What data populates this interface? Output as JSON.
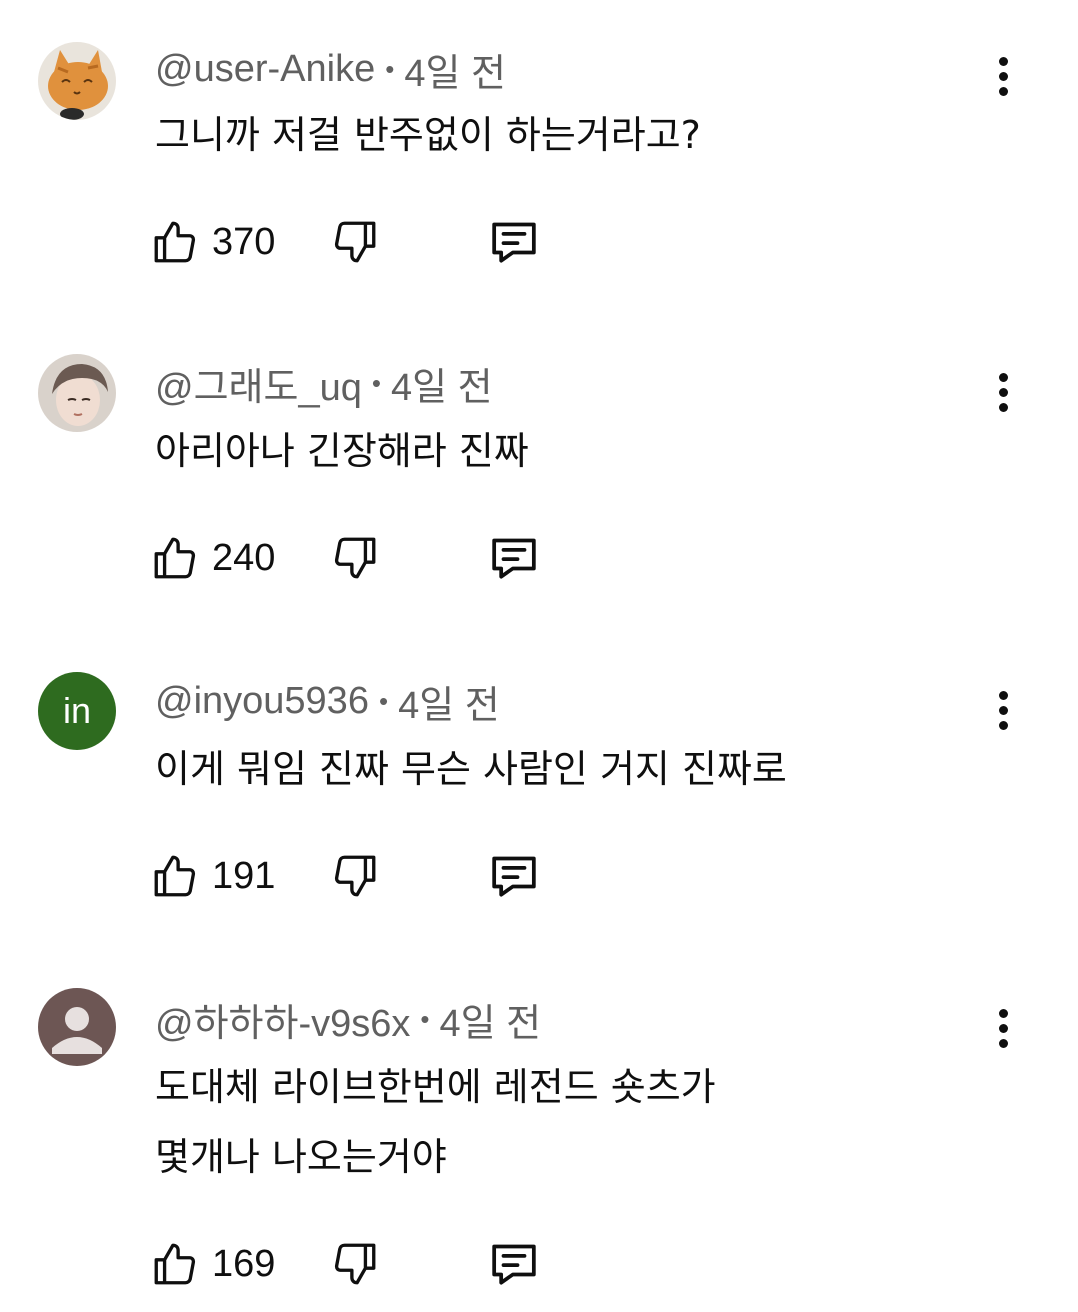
{
  "comments": [
    {
      "author": "@user-Anike",
      "time": "4일 전",
      "text": "그니까 저걸 반주없이 하는거라고?",
      "likes": "370",
      "avatar": "orange-cat-plush"
    },
    {
      "author": "@그래도_uq",
      "time": "4일 전",
      "text": "아리아나 긴장해라 진짜",
      "likes": "240",
      "avatar": "person-photo"
    },
    {
      "author": "@inyou5936",
      "time": "4일 전",
      "text": "이게 뭐임 진짜 무슨 사람인 거지 진짜로",
      "likes": "191",
      "avatar": "in",
      "avatar_color": "#2e6b1f"
    },
    {
      "author": "@하하하-v9s6x",
      "time": "4일 전",
      "text": "도대체 라이브한번에 레전드 숏츠가\n몇개나 나오는거야",
      "likes": "169",
      "avatar": "default-person",
      "avatar_color": "#6d5654"
    }
  ],
  "separator": "•"
}
